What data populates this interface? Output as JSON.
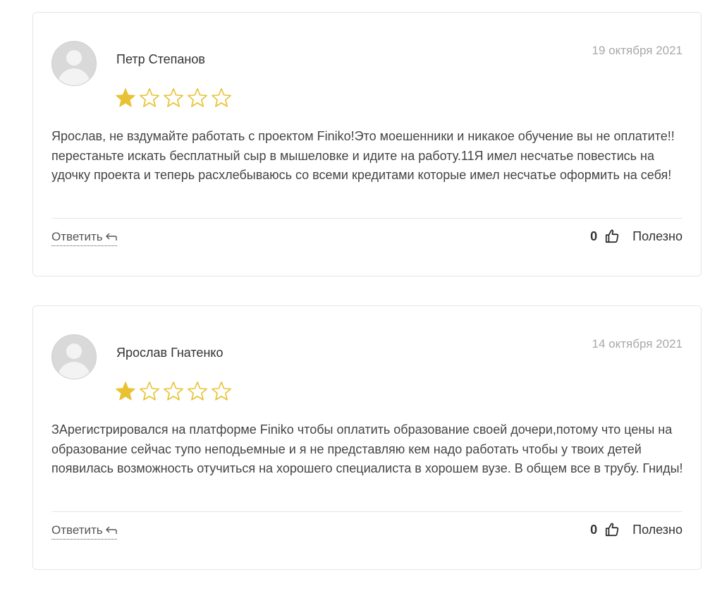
{
  "reviews": [
    {
      "author": "Петр Степанов",
      "date": "19 октября 2021",
      "rating": 1,
      "max_rating": 5,
      "text": "Ярослав, не вздумайте работать с проектом Finiko!Это моешенники и никакое обучение вы не оплатите!!перестаньте искать бесплатный сыр в мышеловке и идите на работу.11Я имел несчатье повестись на удочку проекта и теперь расхлебываюсь со всеми кредитами которые имел несчатье оформить на себя!",
      "reply_label": "Ответить",
      "likes": "0",
      "helpful_label": "Полезно"
    },
    {
      "author": "Ярослав Гнатенко",
      "date": "14 октября 2021",
      "rating": 1,
      "max_rating": 5,
      "text": "ЗАрегистрировался на платформе Finiko чтобы оплатить образование своей дочери,потому что цены на образование сейчас тупо неподьемные и я не представляю кем надо работать чтобы у твоих детей появилась возможность отучиться на хорошего специалиста в хорошем вузе. В общем все в трубу. Гниды!",
      "reply_label": "Ответить",
      "likes": "0",
      "helpful_label": "Полезно"
    }
  ],
  "colors": {
    "star_filled": "#e8c233",
    "star_outline": "#e8c233",
    "date_text": "#a8a8a8",
    "border": "#e6e6e6"
  },
  "icons": {
    "avatar": "default-user-avatar",
    "star": "star-icon",
    "reply": "reply-arrow-icon",
    "like": "thumbs-up-icon"
  }
}
